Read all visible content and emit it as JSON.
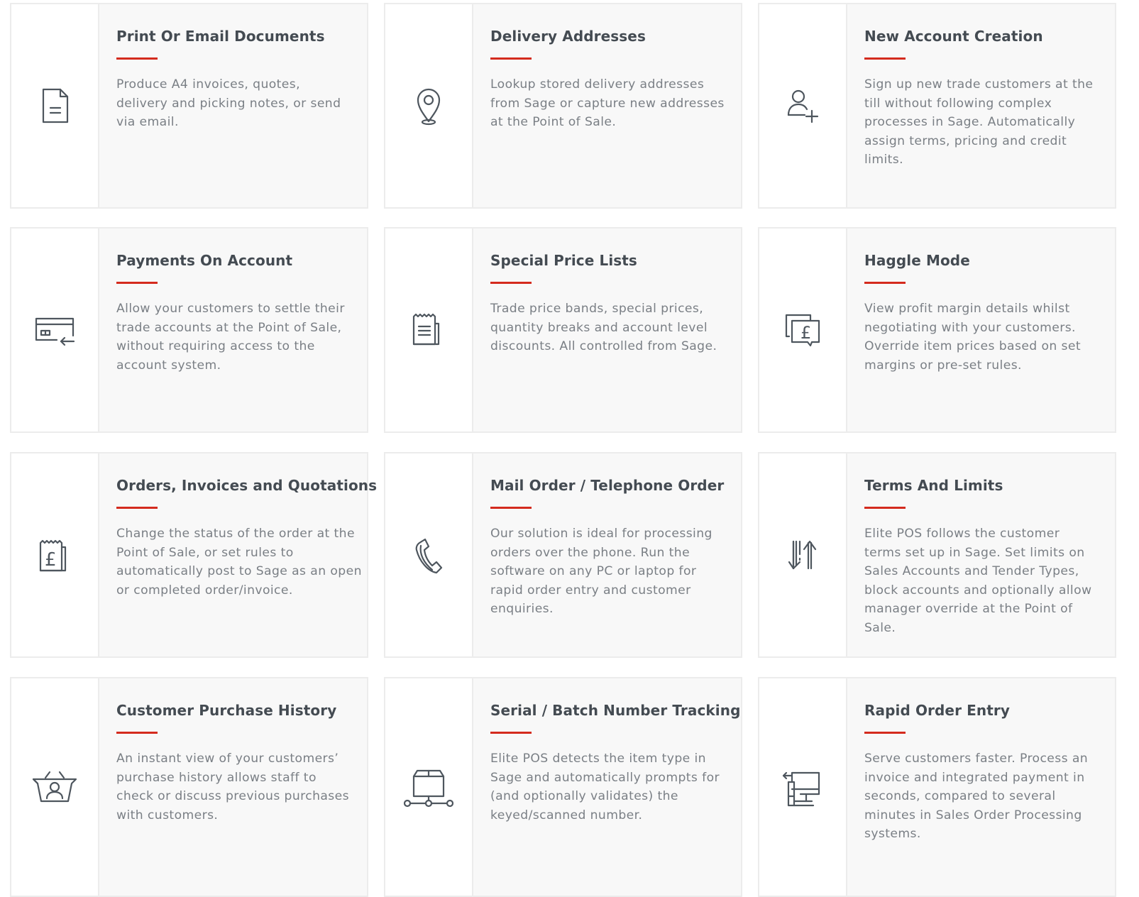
{
  "accent_color": "#d42b1e",
  "features": [
    {
      "title": "Print Or Email Documents",
      "icon": "document-icon",
      "description": "Produce A4 invoices, quotes, delivery and picking notes, or send via email."
    },
    {
      "title": "Delivery Addresses",
      "icon": "location-pin-icon",
      "description": "Lookup stored delivery addresses from Sage or capture new addresses at the Point of Sale."
    },
    {
      "title": "New Account Creation",
      "icon": "add-user-icon",
      "description": "Sign up new trade customers at the till without following complex processes in Sage. Automatically assign terms, pricing and credit limits."
    },
    {
      "title": "Payments On Account",
      "icon": "card-payment-icon",
      "description": "Allow your customers to settle their trade accounts at the Point of Sale, without requiring access to the account system."
    },
    {
      "title": "Special Price Lists",
      "icon": "price-list-receipt-icon",
      "description": "Trade price bands, special prices, quantity breaks and account level discounts. All controlled from Sage."
    },
    {
      "title": "Haggle Mode",
      "icon": "pound-speech-bubble-icon",
      "description": "View profit margin details whilst negotiating with your customers. Override item prices based on set margins or pre-set rules."
    },
    {
      "title": "Orders, Invoices and Quotations",
      "icon": "pound-receipt-icon",
      "description": "Change the status of the order at the Point of Sale, or set rules to automatically post to Sage as an open or completed order/invoice."
    },
    {
      "title": "Mail Order / Telephone Order",
      "icon": "telephone-icon",
      "description": "Our solution is ideal for processing orders over the phone. Run the software on any PC or laptop for rapid order entry and customer enquiries."
    },
    {
      "title": "Terms And Limits",
      "icon": "up-down-arrows-icon",
      "description": "Elite POS follows the customer terms set up in Sage. Set limits on Sales Accounts and Tender Types, block accounts and optionally allow manager override at the Point of Sale."
    },
    {
      "title": "Customer Purchase History",
      "icon": "customer-basket-icon",
      "description": "An instant view of your customers’ purchase history allows staff to check or discuss previous purchases with customers."
    },
    {
      "title": "Serial / Batch Number Tracking",
      "icon": "box-tracking-icon",
      "description": "Elite POS detects the item type in Sage and automatically prompts for (and optionally validates) the keyed/scanned number."
    },
    {
      "title": "Rapid Order Entry",
      "icon": "pos-terminal-icon",
      "description": "Serve customers faster. Process an invoice and integrated payment in seconds, compared to several minutes in Sales Order Processing systems."
    }
  ]
}
